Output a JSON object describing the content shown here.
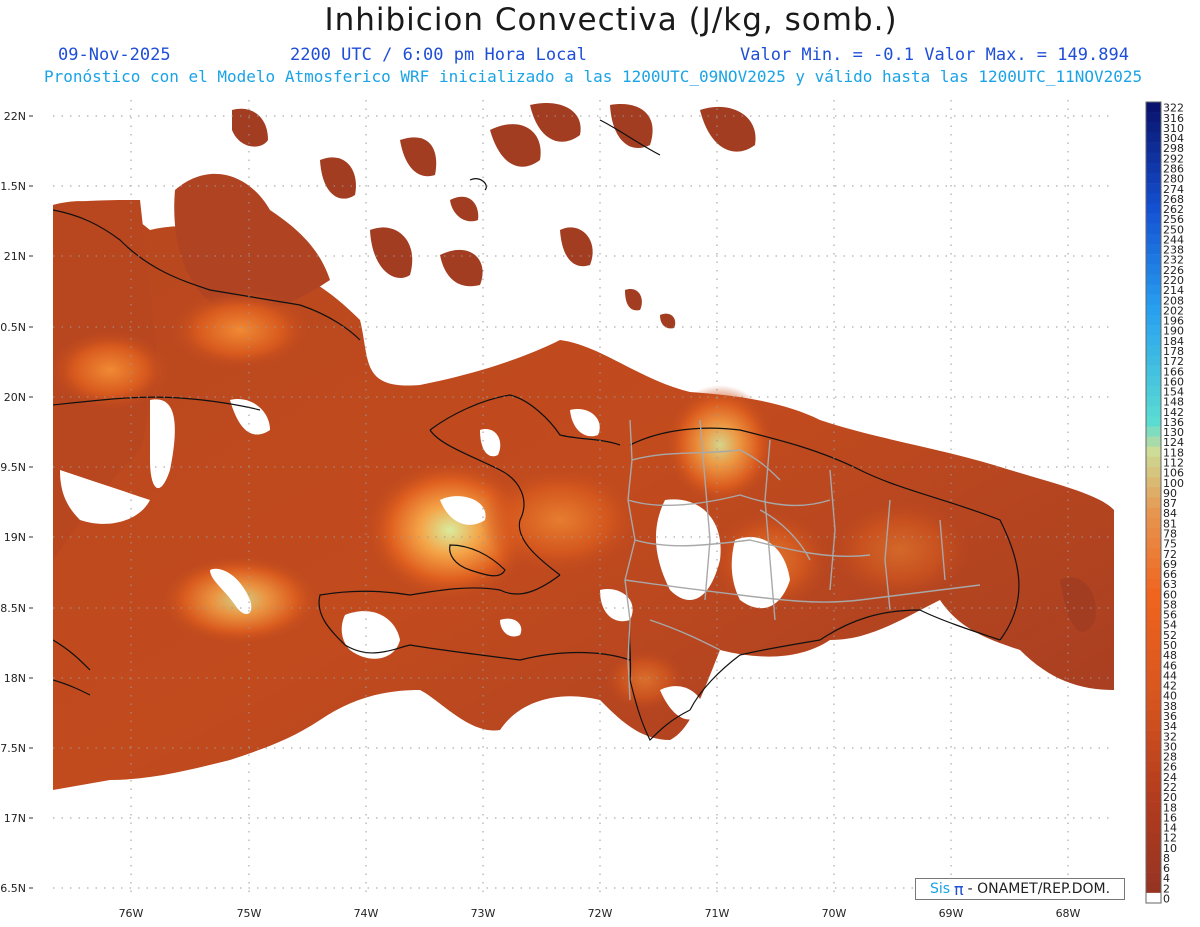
{
  "header": {
    "title": "Inhibicion Convectiva (J/kg, somb.)",
    "date": "09-Nov-2025",
    "time": "2200 UTC / 6:00 pm Hora Local",
    "minmax": "Valor Min. = -0.1  Valor Max. = 149.894",
    "forecast": "Pronóstico con el Modelo Atmosferico WRF inicializado a las 1200UTC_09NOV2025 y válido hasta las  1200UTC_11NOV2025"
  },
  "map": {
    "lat_labels": [
      "22N",
      "1.5N",
      "21N",
      "0.5N",
      "20N",
      "9.5N",
      "19N",
      "8.5N",
      "18N",
      "7.5N",
      "17N",
      "6.5N"
    ],
    "lon_labels": [
      "76W",
      "75W",
      "74W",
      "73W",
      "72W",
      "71W",
      "70W",
      "69W",
      "68W"
    ],
    "fill_colors": {
      "low": "#9e3a22",
      "mid": "#d4531c",
      "high": "#f07a2a",
      "peak": "#d8e89a",
      "coast": "#111111",
      "borders": "#a8a8a8"
    }
  },
  "colorbar": {
    "labels": [
      "322",
      "316",
      "310",
      "304",
      "298",
      "292",
      "286",
      "280",
      "274",
      "268",
      "262",
      "256",
      "250",
      "244",
      "238",
      "232",
      "226",
      "220",
      "214",
      "208",
      "202",
      "196",
      "190",
      "184",
      "178",
      "172",
      "166",
      "160",
      "154",
      "148",
      "142",
      "136",
      "130",
      "124",
      "118",
      "112",
      "106",
      "100",
      "90",
      "87",
      "84",
      "81",
      "78",
      "75",
      "72",
      "69",
      "66",
      "63",
      "60",
      "58",
      "56",
      "54",
      "52",
      "50",
      "48",
      "46",
      "44",
      "42",
      "40",
      "38",
      "36",
      "34",
      "32",
      "30",
      "28",
      "26",
      "24",
      "22",
      "20",
      "18",
      "16",
      "14",
      "12",
      "10",
      "8",
      "6",
      "4",
      "2",
      "0"
    ]
  },
  "credit": {
    "brand": "Sis",
    "pi": "π",
    "text": "- ONAMET/REP.DOM."
  }
}
